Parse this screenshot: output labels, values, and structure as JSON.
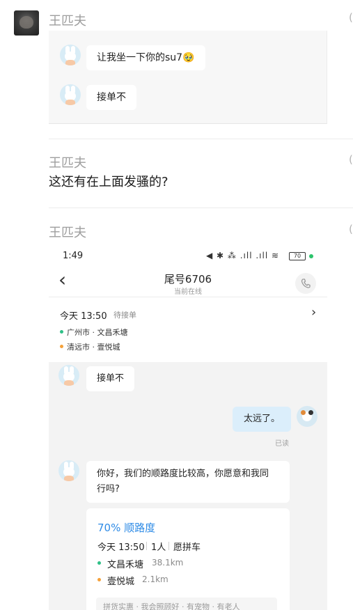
{
  "posts": [
    {
      "sender": "王匹夫",
      "stamp": "("
    },
    {
      "sender": "王匹夫",
      "stamp": "(",
      "text": "这还有在上面发骚的?"
    },
    {
      "sender": "王匹夫",
      "stamp": "("
    }
  ],
  "quoted": {
    "msg1": "让我坐一下你的su7🥹",
    "msg2": "接单不"
  },
  "screenshot": {
    "status_time": "1:49",
    "status_icons": "◀ ✱ ⁂ .ıll .ıll ≋",
    "battery": "70",
    "back_glyph": "‹",
    "title": "尾号6706",
    "subtitle": "当前在线",
    "order": {
      "time": "今天 13:50",
      "status": "待接单",
      "from": "广州市 · 文昌禾塘",
      "to": "清远市 · 壹悦城",
      "chevron": "›"
    },
    "chat": {
      "incoming1": "接单不",
      "outgoing": "太远了。",
      "read_label": "已读",
      "incoming2_line1": "你好，我们的顺路度比较高，你愿意和我同",
      "incoming2_line2": "行吗?"
    },
    "route_card": {
      "percent": "70% 顺路度",
      "time": "今天 13:50",
      "people": "1人",
      "type": "愿拼车",
      "from_name": "文昌禾塘",
      "from_km": "38.1km",
      "to_name": "壹悦城",
      "to_km": "2.1km",
      "footer": "拼货实惠 · 我会照顾好 · 有宠物 · 有老人"
    }
  },
  "colors": {
    "green_dot": "#2fc087",
    "orange_dot": "#f5a13a",
    "accent_blue": "#2e8be6",
    "online_green": "#2cc36b"
  }
}
